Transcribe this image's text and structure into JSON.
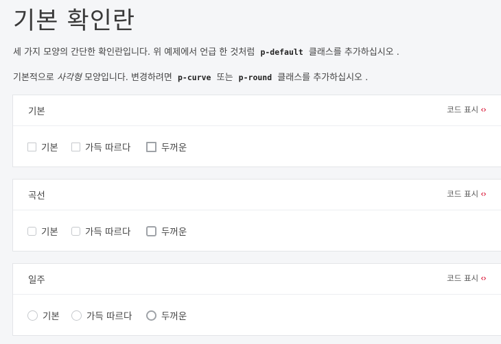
{
  "page": {
    "title": "기본 확인란",
    "desc1": {
      "before": "세 가지 모양의 간단한 확인란입니다. 위 예제에서 언급 한 것처럼",
      "code": "p-default",
      "after": "클래스를 추가하십시오 ."
    },
    "desc2": {
      "before": "기본적으로",
      "em": "사각형",
      "middle": "모양입니다. 변경하려면",
      "code1": "p-curve",
      "or": "또는",
      "code2": "p-round",
      "after": "클래스를 추가하십시오 ."
    }
  },
  "cards": [
    {
      "title": "기본",
      "toggle": "코드 표시",
      "options": [
        "기본",
        "가득 따르다",
        "두꺼운"
      ]
    },
    {
      "title": "곡선",
      "toggle": "코드 표시",
      "options": [
        "기본",
        "가득 따르다",
        "두꺼운"
      ]
    },
    {
      "title": "일주",
      "toggle": "코드 표시",
      "options": [
        "기본",
        "가득 따르다",
        "두꺼운"
      ]
    }
  ],
  "colors": {
    "accent": "#e0405a",
    "background": "#f5f6f8"
  },
  "icons": {
    "code_toggle": "code-brackets-icon"
  }
}
